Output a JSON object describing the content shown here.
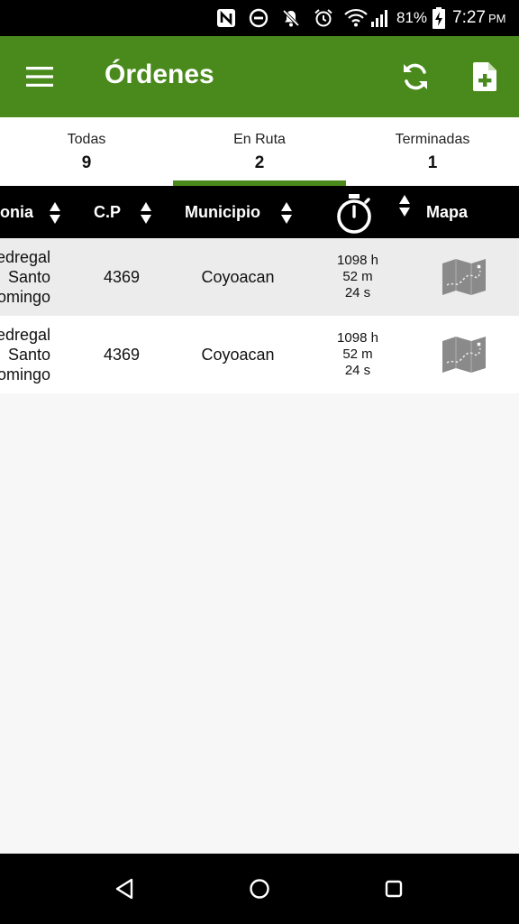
{
  "status_bar": {
    "battery": "81%",
    "time": "7:27",
    "ampm": "PM",
    "icons": [
      "nfc-icon",
      "do-not-disturb-icon",
      "notifications-off-icon",
      "alarm-icon",
      "wifi-icon",
      "signal-icon",
      "battery-charging-icon"
    ]
  },
  "app_bar": {
    "title": "Órdenes",
    "menu_icon": "menu-icon",
    "refresh_icon": "refresh-icon",
    "new_order_icon": "new-document-icon",
    "color": "#4a8a1c"
  },
  "tabs": [
    {
      "label": "Todas",
      "count": "9",
      "selected": false
    },
    {
      "label": "En Ruta",
      "count": "2",
      "selected": true
    },
    {
      "label": "Terminadas",
      "count": "1",
      "selected": false
    }
  ],
  "table": {
    "headers": {
      "colonia": "onia",
      "cp": "C.P",
      "municipio": "Municipio",
      "time_icon": "stopwatch-icon",
      "mapa": "Mapa"
    },
    "rows": [
      {
        "colonia": [
          "edregal",
          "Santo",
          "omingo"
        ],
        "cp": "4369",
        "municipio": "Coyoacan",
        "time": [
          "1098 h",
          "52 m",
          "24 s"
        ],
        "map_icon": "map-icon"
      },
      {
        "colonia": [
          "edregal",
          "Santo",
          "omingo"
        ],
        "cp": "4369",
        "municipio": "Coyoacan",
        "time": [
          "1098 h",
          "52 m",
          "24 s"
        ],
        "map_icon": "map-icon"
      }
    ]
  },
  "nav_bar": {
    "back_icon": "back-icon",
    "home_icon": "home-icon",
    "recents_icon": "recents-icon"
  }
}
